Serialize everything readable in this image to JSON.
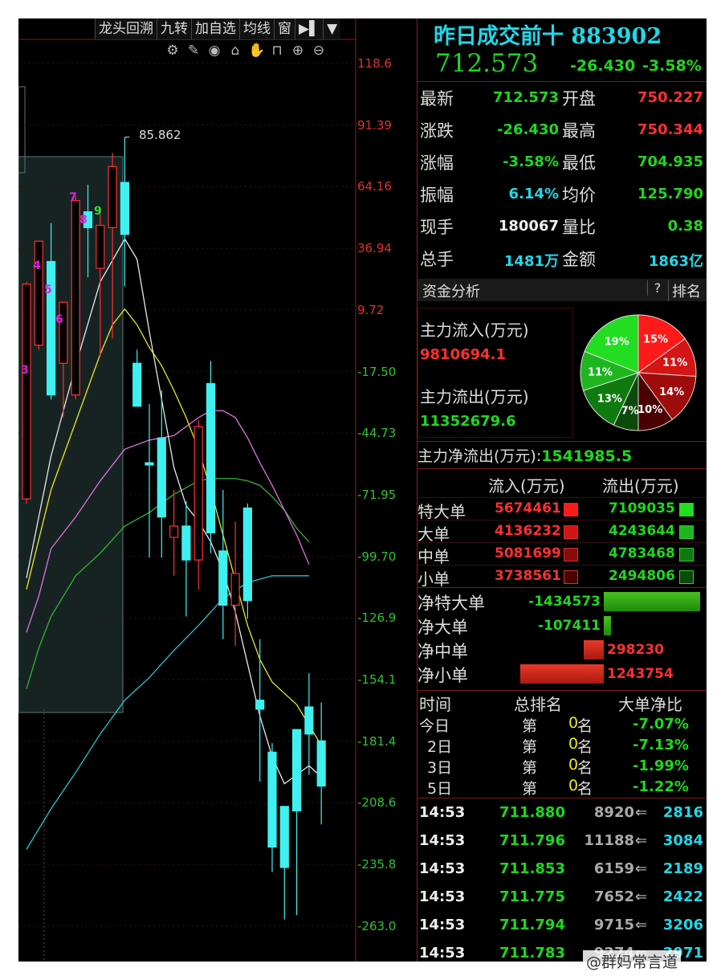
{
  "toolbar": {
    "items": [
      "龙头回溯",
      "九转",
      "加自选",
      "均线",
      "窗",
      "▶▌",
      "▼"
    ]
  },
  "control_icons": [
    "⚙",
    "✎",
    "◉",
    "⌂",
    "✋",
    "⊓",
    "⊕",
    "⊖"
  ],
  "control_icon_names": [
    "settings-icon",
    "draw-icon",
    "eye-icon",
    "print-icon",
    "hand-icon",
    "lock-icon",
    "zoom-in-icon",
    "zoom-out-icon"
  ],
  "chart_data": {
    "type": "candlestick",
    "y_ticks": [
      "118.6",
      "91.39",
      "64.16",
      "36.94",
      "9.72",
      "-17.50",
      "-44.73",
      "-71.95",
      "-99.70",
      "-126.9",
      "-154.1",
      "-181.4",
      "-208.6",
      "-235.8",
      "-263.0"
    ],
    "peak_label": "85.862",
    "nine_turn_labels": [
      "3",
      "4",
      "5",
      "6",
      "7",
      "8",
      "9"
    ],
    "candles": [
      {
        "o": -74,
        "c": 21,
        "h": 22,
        "l": -76
      },
      {
        "o": -6,
        "c": 40,
        "h": 40,
        "l": -8
      },
      {
        "o": 31,
        "c": -28,
        "h": 48,
        "l": -30
      },
      {
        "o": -14,
        "c": 13,
        "h": 13,
        "l": -38
      },
      {
        "o": -28,
        "c": 58,
        "h": 60,
        "l": -30
      },
      {
        "o": 53,
        "c": 46,
        "h": 65,
        "l": 24
      },
      {
        "o": 28,
        "c": 47,
        "h": 55,
        "l": -11
      },
      {
        "o": 46,
        "c": 73,
        "h": 79,
        "l": -3
      },
      {
        "o": 66,
        "c": 43,
        "h": 86,
        "l": 20
      },
      {
        "o": -14,
        "c": -33,
        "h": -8,
        "l": -33
      },
      {
        "o": -58,
        "c": -59,
        "h": -32,
        "l": -100
      },
      {
        "o": -47,
        "c": -82,
        "h": -26,
        "l": -100
      },
      {
        "o": -91,
        "c": -86,
        "h": -70,
        "l": -108
      },
      {
        "o": -86,
        "c": -101,
        "h": -75,
        "l": -126
      },
      {
        "o": -101,
        "c": -42,
        "h": -39,
        "l": -114
      },
      {
        "o": -23,
        "c": -89,
        "h": -13,
        "l": -98
      },
      {
        "o": -97,
        "c": -121,
        "h": -70,
        "l": -136
      },
      {
        "o": -121,
        "c": -107,
        "h": -84,
        "l": -139
      },
      {
        "o": -78,
        "c": -119,
        "h": -76,
        "l": -127
      },
      {
        "o": -163,
        "c": -167,
        "h": -136,
        "l": -199
      },
      {
        "o": -186,
        "c": -228,
        "h": -182,
        "l": -239
      },
      {
        "o": -210,
        "c": -237,
        "h": -210,
        "l": -260
      },
      {
        "o": -176,
        "c": -212,
        "h": -176,
        "l": -258
      },
      {
        "o": -166,
        "c": -178,
        "h": -151,
        "l": -196
      },
      {
        "o": -181,
        "c": -201,
        "h": -164,
        "l": -218
      }
    ],
    "ma_white": [
      [
        0,
        -109
      ],
      [
        2,
        -55
      ],
      [
        4,
        -15
      ],
      [
        6,
        22
      ],
      [
        8,
        41
      ],
      [
        9,
        32
      ],
      [
        10,
        0
      ],
      [
        11,
        -30
      ],
      [
        12,
        -60
      ],
      [
        13,
        -77
      ],
      [
        14,
        -84
      ],
      [
        15,
        -93
      ],
      [
        16,
        -106
      ],
      [
        17,
        -124
      ],
      [
        18,
        -147
      ],
      [
        19,
        -170
      ],
      [
        20,
        -188
      ],
      [
        21,
        -200
      ],
      [
        22,
        -196
      ],
      [
        23,
        -192
      ],
      [
        24,
        -197
      ]
    ],
    "ma_yellow": [
      [
        0,
        -114
      ],
      [
        2,
        -70
      ],
      [
        4,
        -40
      ],
      [
        6,
        -10
      ],
      [
        7,
        3
      ],
      [
        8,
        10
      ],
      [
        9,
        3
      ],
      [
        10,
        -7
      ],
      [
        11,
        -15
      ],
      [
        12,
        -26
      ],
      [
        13,
        -38
      ],
      [
        14,
        -52
      ],
      [
        15,
        -70
      ],
      [
        16,
        -90
      ],
      [
        17,
        -110
      ],
      [
        18,
        -130
      ],
      [
        19,
        -145
      ],
      [
        20,
        -155
      ],
      [
        21,
        -160
      ],
      [
        22,
        -165
      ],
      [
        23,
        -174
      ],
      [
        24,
        -183
      ]
    ],
    "ma_pink": [
      [
        0,
        -133
      ],
      [
        1,
        -117
      ],
      [
        2,
        -96
      ],
      [
        4,
        -82
      ],
      [
        6,
        -66
      ],
      [
        8,
        -52
      ],
      [
        10,
        -48
      ],
      [
        12,
        -46
      ],
      [
        14,
        -38
      ],
      [
        15,
        -35
      ],
      [
        16,
        -35
      ],
      [
        17,
        -38
      ],
      [
        18,
        -47
      ],
      [
        19,
        -58
      ],
      [
        20,
        -68
      ],
      [
        21,
        -79
      ],
      [
        22,
        -90
      ],
      [
        23,
        -103
      ]
    ],
    "ma_green": [
      [
        0,
        -158
      ],
      [
        1,
        -140
      ],
      [
        2,
        -126
      ],
      [
        4,
        -108
      ],
      [
        6,
        -98
      ],
      [
        8,
        -86
      ],
      [
        10,
        -80
      ],
      [
        12,
        -72
      ],
      [
        14,
        -66
      ],
      [
        15,
        -65
      ],
      [
        16,
        -65
      ],
      [
        17,
        -65
      ],
      [
        18,
        -66
      ],
      [
        19,
        -68
      ],
      [
        20,
        -73
      ],
      [
        21,
        -79
      ],
      [
        22,
        -87
      ],
      [
        23,
        -93
      ]
    ],
    "ma_cyan": [
      [
        0,
        -229
      ],
      [
        2,
        -211
      ],
      [
        4,
        -195
      ],
      [
        6,
        -178
      ],
      [
        8,
        -163
      ],
      [
        10,
        -153
      ],
      [
        12,
        -141
      ],
      [
        14,
        -130
      ],
      [
        16,
        -118
      ],
      [
        18,
        -111
      ],
      [
        20,
        -108
      ],
      [
        21,
        -108
      ],
      [
        22,
        -108
      ],
      [
        23,
        -108
      ]
    ]
  },
  "quote": {
    "title": "昨日成交前十 883902",
    "price": "712.573",
    "change": "-26.430",
    "change_pct": "-3.58%",
    "rows": [
      {
        "l1": "最新",
        "v1": "712.573",
        "c1": "green",
        "l2": "开盘",
        "v2": "750.227",
        "c2": "red"
      },
      {
        "l1": "涨跌",
        "v1": "-26.430",
        "c1": "green",
        "l2": "最高",
        "v2": "750.344",
        "c2": "red"
      },
      {
        "l1": "涨幅",
        "v1": "-3.58%",
        "c1": "green",
        "l2": "最低",
        "v2": "704.935",
        "c2": "green"
      },
      {
        "l1": "振幅",
        "v1": "6.14%",
        "c1": "cyan",
        "l2": "均价",
        "v2": "125.790",
        "c2": "green"
      },
      {
        "l1": "现手",
        "v1": "180067",
        "c1": "white",
        "l2": "量比",
        "v2": "0.38",
        "c2": "green"
      },
      {
        "l1": "总手",
        "v1": "1481万",
        "c1": "cyan",
        "l2": "金额",
        "v2": "1863亿",
        "c2": "cyan"
      }
    ]
  },
  "fund": {
    "section_title": "资金分析",
    "help": "?",
    "rank_button": "排名",
    "inflow_label": "主力流入(万元)",
    "inflow_value": "9810694.1",
    "outflow_label": "主力流出(万元)",
    "outflow_value": "11352679.6",
    "net_label": "主力净流出(万元):",
    "net_value": "1541985.5",
    "pie": [
      {
        "label": "15%",
        "value": 15,
        "color": "#ff1a1a"
      },
      {
        "label": "11%",
        "value": 11,
        "color": "#d51414"
      },
      {
        "label": "14%",
        "value": 14,
        "color": "#9e0b0b"
      },
      {
        "label": "10%",
        "value": 10,
        "color": "#4a0000"
      },
      {
        "label": "7%",
        "value": 7,
        "color": "#0b4a0b"
      },
      {
        "label": "13%",
        "value": 13,
        "color": "#0f7a0f"
      },
      {
        "label": "11%",
        "value": 11,
        "color": "#1fb51f"
      },
      {
        "label": "19%",
        "value": 19,
        "color": "#22dd22"
      }
    ],
    "table_headers": [
      "流入(万元)",
      "流出(万元)"
    ],
    "rows": [
      {
        "label": "特大单",
        "in": "5674461",
        "out": "7109035",
        "in_color": "#ff1a1a",
        "out_color": "#22dd22"
      },
      {
        "label": "大单",
        "in": "4136232",
        "out": "4243644",
        "in_color": "#d51414",
        "out_color": "#1fb51f"
      },
      {
        "label": "中单",
        "in": "5081699",
        "out": "4783468",
        "in_color": "#8a0b0b",
        "out_color": "#0f7a0f"
      },
      {
        "label": "小单",
        "in": "3738561",
        "out": "2494806",
        "in_color": "#4a0000",
        "out_color": "#0b4a0b"
      }
    ],
    "net_rows": [
      {
        "label": "净特大单",
        "value": "-1434573",
        "net": -1434573
      },
      {
        "label": "净大单",
        "value": "-107411",
        "net": -107411
      },
      {
        "label": "净中单",
        "value": "298230",
        "net": 298230
      },
      {
        "label": "净小单",
        "value": "1243754",
        "net": 1243754
      }
    ]
  },
  "ranking": {
    "headers": [
      "时间",
      "总排名",
      "大单净比"
    ],
    "rows": [
      {
        "period": "今日",
        "di": "第",
        "rank": "0",
        "ming": "名",
        "ratio": "-7.07%"
      },
      {
        "period": "2日",
        "di": "第",
        "rank": "0",
        "ming": "名",
        "ratio": "-7.13%"
      },
      {
        "period": "3日",
        "di": "第",
        "rank": "0",
        "ming": "名",
        "ratio": "-1.99%"
      },
      {
        "period": "5日",
        "di": "第",
        "rank": "0",
        "ming": "名",
        "ratio": "-1.22%"
      }
    ]
  },
  "ticks": [
    {
      "time": "14:53",
      "price": "711.880",
      "vol": "8920",
      "count": "2816"
    },
    {
      "time": "14:53",
      "price": "711.796",
      "vol": "11188",
      "count": "3084"
    },
    {
      "time": "14:53",
      "price": "711.853",
      "vol": "6159",
      "count": "2189"
    },
    {
      "time": "14:53",
      "price": "711.775",
      "vol": "7652",
      "count": "2422"
    },
    {
      "time": "14:53",
      "price": "711.794",
      "vol": "9715",
      "count": "3206"
    },
    {
      "time": "14:53",
      "price": "711.783",
      "vol": "9274",
      "count": "2971"
    }
  ],
  "watermark": "@群妈常言道",
  "colors": {
    "up": "#ff3030",
    "down": "#3ff0f0",
    "accent": "#22d7e8",
    "green": "#1fd71f"
  }
}
